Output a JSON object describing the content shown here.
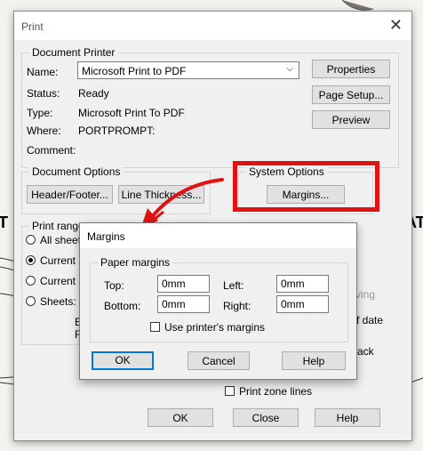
{
  "print_dialog": {
    "title": "Print",
    "close_glyph": "✕",
    "document_printer": {
      "label": "Document Printer",
      "name_label": "Name:",
      "name_value": "Microsoft Print to PDF",
      "status_label": "Status:",
      "status_value": "Ready",
      "type_label": "Type:",
      "type_value": "Microsoft Print To PDF",
      "where_label": "Where:",
      "where_value": "PORTPROMPT:",
      "comment_label": "Comment:",
      "properties_button": "Properties",
      "page_setup_button": "Page Setup...",
      "preview_button": "Preview"
    },
    "document_options": {
      "label": "Document Options",
      "header_footer_button": "Header/Footer...",
      "line_thickness_button": "Line Thickness..."
    },
    "system_options": {
      "label": "System Options",
      "margins_button": "Margins..."
    },
    "print_range": {
      "label": "Print range",
      "all_sheets": "All sheet",
      "current_1": "Current s",
      "current_2": "Current s",
      "sheets": "Sheets:"
    },
    "partial_texts": {
      "ving": "ving",
      "date": "f date",
      "ack": "ack",
      "e_f_1": "E",
      "e_f_2": "F"
    },
    "print_zone_lines": "Print zone lines",
    "ok_button": "OK",
    "close_button": "Close",
    "help_button": "Help"
  },
  "margins_dialog": {
    "title": "Margins",
    "paper_margins_label": "Paper margins",
    "top_label": "Top:",
    "top_value": "0mm",
    "left_label": "Left:",
    "left_value": "0mm",
    "bottom_label": "Bottom:",
    "bottom_value": "0mm",
    "right_label": "Right:",
    "right_value": "0mm",
    "use_printer_margins": "Use printer's margins",
    "ok_button": "OK",
    "cancel_button": "Cancel",
    "help_button": "Help"
  },
  "background": {
    "left_fragment": "T",
    "right_fragment": "AT"
  },
  "colors": {
    "highlight": "#e01212",
    "accent": "#0078d7"
  }
}
